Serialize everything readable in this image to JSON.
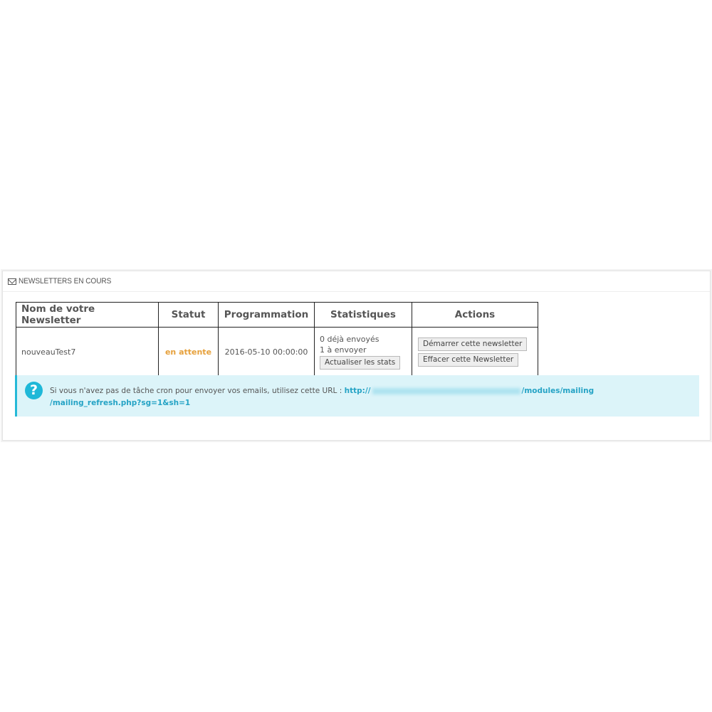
{
  "panel": {
    "heading_icon": "envelope-icon",
    "title": "NEWSLETTERS EN COURS"
  },
  "table": {
    "headers": [
      "Nom de votre Newsletter",
      "Statut",
      "Programmation",
      "Statistiques",
      "Actions"
    ],
    "rows": [
      {
        "name": "nouveauTest7",
        "status": "en attente",
        "schedule": "2016-05-10 00:00:00",
        "stats_sent": "0 déjà envoyés",
        "stats_to_send": "1 à envoyer",
        "refresh_stats_label": "Actualiser les stats",
        "start_label": "Démarrer cette newsletter",
        "delete_label": "Effacer cette Newsletter"
      }
    ]
  },
  "alert": {
    "icon": "question-icon",
    "text": "Si vous n'avez pas de tâche cron pour envoyer vos emails, utilisez cette URL :",
    "url_prefix": "http://",
    "url_suffix_line1": "/modules/mailing",
    "url_line2": "/mailing_refresh.php?sg=1&sh=1"
  },
  "colors": {
    "status_pending": "#e6a03b",
    "alert_bg": "#dcf4f9",
    "alert_border": "#25b9d7",
    "link": "#25a3c5"
  }
}
